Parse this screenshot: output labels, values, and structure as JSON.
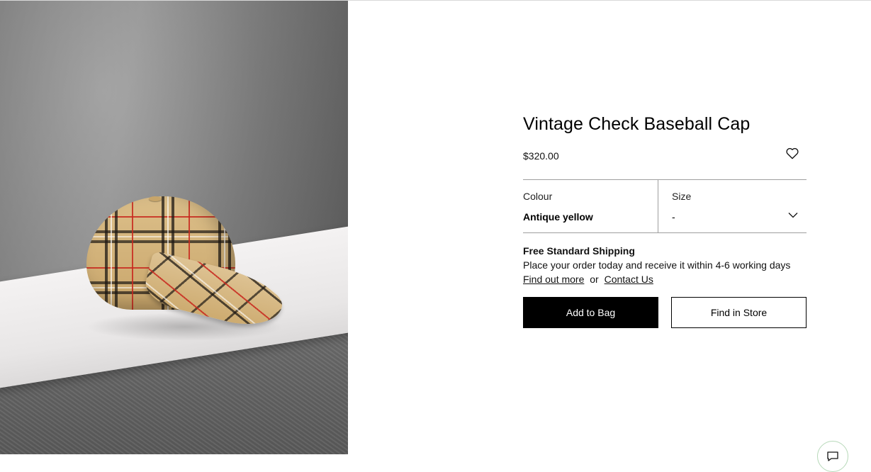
{
  "product": {
    "title": "Vintage Check Baseball Cap",
    "price": "$320.00",
    "image_alt": "Vintage check baseball cap on a marble slab"
  },
  "options": {
    "colour": {
      "label": "Colour",
      "value": "Antique yellow"
    },
    "size": {
      "label": "Size",
      "value": "-"
    }
  },
  "shipping": {
    "title": "Free Standard Shipping",
    "description": "Place your order today and receive it within 4-6 working days",
    "find_out_more": "Find out more",
    "separator": "or",
    "contact_us": "Contact Us"
  },
  "actions": {
    "add_to_bag": "Add to Bag",
    "find_in_store": "Find in Store"
  },
  "icons": {
    "wishlist": "heart-icon",
    "size_dropdown": "chevron-down-icon",
    "chat": "chat-icon"
  },
  "colors": {
    "primary_button_bg": "#000000",
    "primary_button_text": "#ffffff",
    "divider": "#9e9e9e",
    "chat_border": "#b7d9b9"
  }
}
